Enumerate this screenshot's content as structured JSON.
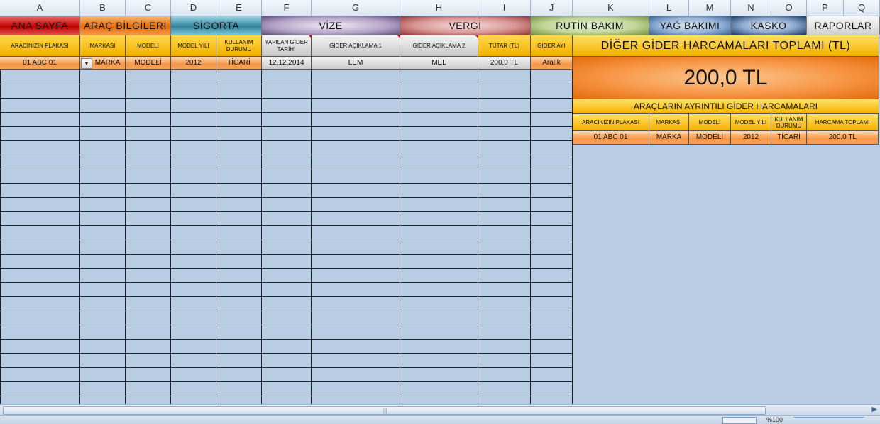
{
  "columns": [
    "A",
    "B",
    "C",
    "D",
    "E",
    "F",
    "G",
    "H",
    "I",
    "J",
    "K",
    "L",
    "M",
    "N",
    "O",
    "P",
    "Q"
  ],
  "nav_tabs": {
    "ana_sayfa": "ANA SAYFA",
    "arac_bilgileri": "ARAÇ BİLGİLERİ",
    "sigorta": "SİGORTA",
    "vize": "VİZE",
    "vergi": "VERGİ",
    "rutin_bakim": "RUTİN BAKIM",
    "yag_bakimi": "YAĞ BAKIMI",
    "kasko": "KASKO",
    "raporlar": "RAPORLAR"
  },
  "table": {
    "headers": {
      "plaka": "ARACINIZIN PLAKASI",
      "markasi": "MARKASI",
      "modeli": "MODELİ",
      "model_yili": "MODEL YILI",
      "kullanim": "KULLANIM DURUMU",
      "tarih": "YAPILAN GİDER TARİHİ",
      "aciklama1": "GİDER AÇIKLAMA 1",
      "aciklama2": "GİDER AÇIKLAMA 2",
      "tutar": "TUTAR (TL)",
      "ay": "GİDER AYI"
    },
    "row": {
      "plaka": "01 ABC 01",
      "markasi": "MARKA",
      "modeli": "MODELİ",
      "model_yili": "2012",
      "kullanim": "TİCARİ",
      "tarih": "12.12.2014",
      "aciklama1": "LEM",
      "aciklama2": "MEL",
      "tutar": "200,0 TL",
      "ay": "Aralık"
    }
  },
  "summary": {
    "title": "DİĞER GİDER HARCAMALARI TOPLAMI (TL)",
    "total": "200,0 TL",
    "subtitle": "ARAÇLARIN AYRINTILI GİDER HARCAMALARI",
    "headers": {
      "plaka": "ARACINIZIN PLAKASI",
      "markasi": "MARKASI",
      "modeli": "MODELİ",
      "model_yili": "MODEL YILI",
      "kullanim": "KULLANIM DURUMU",
      "toplam": "HARCAMA TOPLAMI"
    },
    "row": {
      "plaka": "01 ABC 01",
      "markasi": "MARKA",
      "modeli": "MODELİ",
      "model_yili": "2012",
      "kullanim": "TİCARİ",
      "toplam": "200,0 TL"
    }
  },
  "status_bar": {
    "zoom": "%100"
  },
  "colors": {
    "background": "#b8cce4",
    "accent_orange": "#f79646",
    "header_yellow": "#f4b000"
  }
}
